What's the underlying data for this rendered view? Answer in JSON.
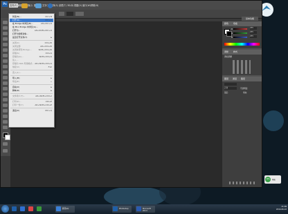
{
  "menubar": {
    "items": [
      {
        "label": "文件(F)"
      },
      {
        "label": "编辑(E)"
      },
      {
        "label": "图像(I)"
      },
      {
        "label": "图层(L)"
      },
      {
        "label": "文字(Y)"
      },
      {
        "label": "选择(S)"
      },
      {
        "label": "滤镜(T)"
      },
      {
        "label": "3D(D)"
      },
      {
        "label": "视图(V)"
      },
      {
        "label": "窗口(W)"
      },
      {
        "label": "帮助(H)"
      }
    ]
  },
  "workspace": {
    "label": "基本功能"
  },
  "file_menu": {
    "items": [
      {
        "label": "新建(N)...",
        "shortcut": "Ctrl+N",
        "enabled": true
      },
      {
        "label": "打开(O)...",
        "shortcut": "Ctrl+O",
        "enabled": true,
        "highlighted": true
      },
      {
        "label": "在 Bridge 中浏览(B)...",
        "shortcut": "Alt+Ctrl+O",
        "enabled": true
      },
      {
        "label": "在 Mini Bridge 中浏览(G)...",
        "shortcut": "",
        "enabled": true
      },
      {
        "label": "打开为...",
        "shortcut": "Alt+Shift+Ctrl+O",
        "enabled": true
      },
      {
        "label": "打开为智能对象...",
        "shortcut": "",
        "enabled": true
      },
      {
        "label": "最近打开文件(T)",
        "shortcut": "",
        "enabled": true,
        "submenu": true
      },
      {
        "separator": true
      },
      {
        "label": "关闭(C)",
        "shortcut": "Ctrl+W",
        "enabled": false
      },
      {
        "label": "关闭全部",
        "shortcut": "Alt+Ctrl+W",
        "enabled": false
      },
      {
        "label": "关闭并转到 Bridge...",
        "shortcut": "Shift+Ctrl+W",
        "enabled": false
      },
      {
        "label": "存储(S)",
        "shortcut": "Ctrl+S",
        "enabled": false
      },
      {
        "label": "存储为(A)...",
        "shortcut": "Shift+Ctrl+S",
        "enabled": false
      },
      {
        "label": "签入...",
        "shortcut": "",
        "enabled": false
      },
      {
        "label": "存储为 Web 所用格式...",
        "shortcut": "Alt+Shift+Ctrl+S",
        "enabled": false
      },
      {
        "label": "恢复(V)",
        "shortcut": "F12",
        "enabled": false
      },
      {
        "separator": true
      },
      {
        "label": "置入(L)...",
        "shortcut": "",
        "enabled": false
      },
      {
        "separator": true
      },
      {
        "label": "导入(M)",
        "shortcut": "",
        "enabled": true,
        "submenu": true
      },
      {
        "label": "导出(E)",
        "shortcut": "",
        "enabled": false,
        "submenu": true
      },
      {
        "separator": true
      },
      {
        "label": "自动(U)",
        "shortcut": "",
        "enabled": true,
        "submenu": true
      },
      {
        "label": "脚本(R)",
        "shortcut": "",
        "enabled": true,
        "submenu": true
      },
      {
        "separator": true
      },
      {
        "label": "文件简介(F)...",
        "shortcut": "Alt+Shift+Ctrl+I",
        "enabled": false
      },
      {
        "separator": true
      },
      {
        "label": "打印(P)...",
        "shortcut": "Ctrl+P",
        "enabled": false
      },
      {
        "label": "打印一份(Y)",
        "shortcut": "Alt+Shift+Ctrl+P",
        "enabled": false
      },
      {
        "separator": true
      },
      {
        "label": "退出(X)",
        "shortcut": "Ctrl+Q",
        "enabled": true
      }
    ]
  },
  "panels": {
    "color_tab": "颜色",
    "swatches_tab": "色板",
    "color_labels": [
      "R",
      "G",
      "B"
    ],
    "color_values": [
      "255",
      "255",
      "255"
    ],
    "adjust_tab": "调整",
    "styles_tab": "样式",
    "adjust_title": "添加调整",
    "layers_tab": "图层",
    "channels_tab": "通道",
    "paths_tab": "路径",
    "blend_mode": "正常",
    "opacity_label": "不透明度:",
    "lock_label": "锁定:",
    "fill_label": "填充:",
    "colors": {
      "red": "#d23a3a",
      "green": "#33a43a",
      "blue": "#3a5fd2"
    }
  },
  "taskbar": {
    "start": "start-orb",
    "items": [
      {
        "label": "Photoshop CS6",
        "color": "#1f5fa8"
      },
      {
        "label": "百度",
        "color": "#2f6fd0"
      },
      {
        "label": "Google Chrome",
        "color": "#d44"
      },
      {
        "label": "360",
        "color": "#3a9a3a"
      },
      {
        "label": "腾讯QQ",
        "color": "#3a80d8"
      },
      {
        "label": "Photoshop",
        "color": "#1f5fa8"
      },
      {
        "label": "Microsoft Word",
        "color": "#2a5ab0"
      }
    ],
    "clock_time": "21:09",
    "clock_date": "2014-06-22"
  },
  "notification": {
    "percent": "79%",
    "text": "网速"
  }
}
